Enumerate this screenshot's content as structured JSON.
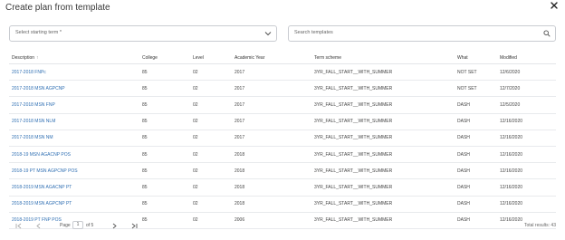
{
  "dialog": {
    "title": "Create plan from template"
  },
  "filters": {
    "term_placeholder": "Select starting term *",
    "search_placeholder": "Search templates"
  },
  "table": {
    "columns": [
      "Description",
      "College",
      "Level",
      "Academic Year",
      "Term scheme",
      "What",
      "Modified"
    ],
    "sort_indicator": "↑",
    "rows": [
      [
        "2017-2018 FNPc",
        "85",
        "02",
        "2017",
        "3YR_FALL_START__WITH_SUMMER",
        "NOT SET",
        "12/6/2020"
      ],
      [
        "2017-2018 MSN AGPCNP",
        "85",
        "02",
        "2017",
        "3YR_FALL_START__WITH_SUMMER",
        "NOT SET",
        "12/7/2020"
      ],
      [
        "2017-2018 MSN FNP",
        "85",
        "02",
        "2017",
        "3YR_FALL_START__WITH_SUMMER",
        "DASH",
        "12/5/2020"
      ],
      [
        "2017-2018 MSN NLM",
        "85",
        "02",
        "2017",
        "3YR_FALL_START__WITH_SUMMER",
        "DASH",
        "12/16/2020"
      ],
      [
        "2017-2018 MSN NM",
        "85",
        "02",
        "2017",
        "3YR_FALL_START__WITH_SUMMER",
        "DASH",
        "12/16/2020"
      ],
      [
        "2018-19 MSN AGACNP POS",
        "85",
        "02",
        "2018",
        "3YR_FALL_START__WITH_SUMMER",
        "DASH",
        "12/16/2020"
      ],
      [
        "2018-19 PT MSN AGPCNP POS",
        "85",
        "02",
        "2018",
        "3YR_FALL_START__WITH_SUMMER",
        "DASH",
        "12/16/2020"
      ],
      [
        "2018-2019 MSN AGACNP PT",
        "85",
        "02",
        "2018",
        "3YR_FALL_START__WITH_SUMMER",
        "DASH",
        "12/16/2020"
      ],
      [
        "2018-2019 MSN AGPCNP PT",
        "85",
        "02",
        "2018",
        "3YR_FALL_START__WITH_SUMMER",
        "DASH",
        "12/16/2020"
      ],
      [
        "2018-2019 PT FNP POS",
        "85",
        "02",
        "2006",
        "3YR_FALL_START__WITH_SUMMER",
        "DASH",
        "12/16/2020"
      ]
    ]
  },
  "pager": {
    "page_label": "Page",
    "page_value": "1",
    "of_label": "of 5",
    "total": "Total results: 43"
  },
  "colors": {
    "link": "#2f6fb3",
    "border": "#c9ccd1"
  }
}
